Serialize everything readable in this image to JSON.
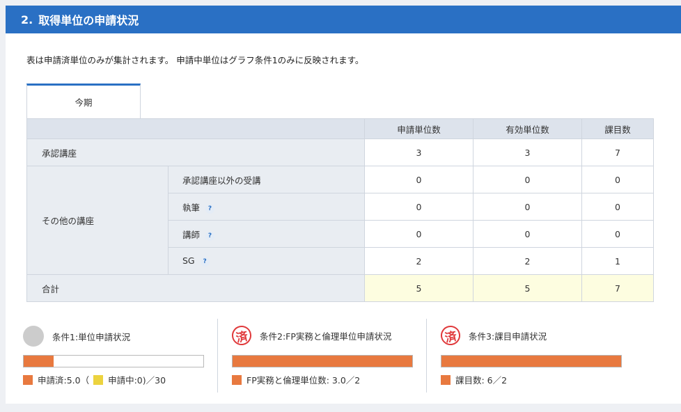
{
  "header": {
    "number": "2.",
    "title": "取得単位の申請状況"
  },
  "note": "表は申請済単位のみが集計されます。 申請中単位はグラフ条件1のみに反映されます。",
  "tab": {
    "label": "今期"
  },
  "table": {
    "columns": [
      "申請単位数",
      "有効単位数",
      "課目数"
    ],
    "approved": {
      "label": "承認講座",
      "values": [
        "3",
        "3",
        "7"
      ]
    },
    "other": {
      "label": "その他の講座",
      "rows": [
        {
          "label": "承認講座以外の受講",
          "values": [
            "0",
            "0",
            "0"
          ]
        },
        {
          "label": "執筆",
          "values": [
            "0",
            "0",
            "0"
          ]
        },
        {
          "label": "講師",
          "values": [
            "0",
            "0",
            "0"
          ]
        },
        {
          "label": "SG",
          "values": [
            "2",
            "2",
            "1"
          ]
        }
      ]
    },
    "total": {
      "label": "合計",
      "values": [
        "5",
        "5",
        "7"
      ]
    },
    "help_glyph": "?"
  },
  "conditions": [
    {
      "title": "条件1:単位申請状況",
      "progress": 0.1667,
      "legend_applied": "申請済:5.0（",
      "legend_pending": "申請中:0)／30"
    },
    {
      "title": "条件2:FP実務と倫理単位申請状況",
      "stamp": "済",
      "progress": 1.0,
      "legend": "FP実務と倫理単位数: 3.0／2"
    },
    {
      "title": "条件3:課目申請状況",
      "stamp": "済",
      "progress": 1.0,
      "legend": "課目数: 6／2"
    }
  ],
  "colors": {
    "header": "#2a70c4",
    "bar_fill": "#e8793f",
    "pending": "#ecd33f",
    "stamp": "#e0393b"
  }
}
